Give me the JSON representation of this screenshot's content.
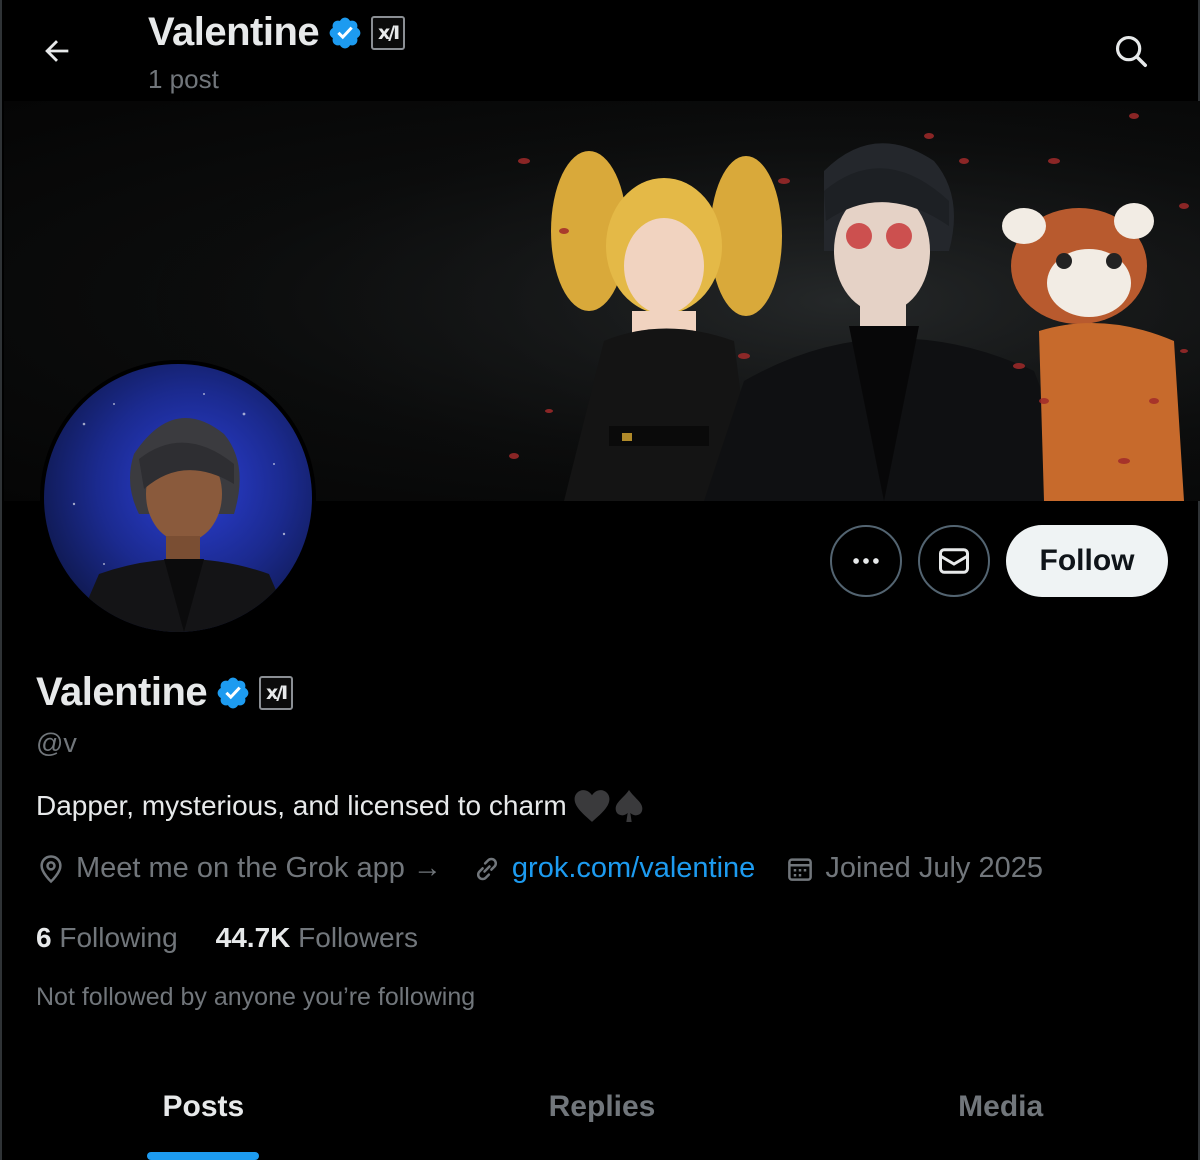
{
  "header": {
    "name": "Valentine",
    "post_count": "1 post",
    "back_icon": "arrow-left-icon",
    "search_icon": "search-icon"
  },
  "profile": {
    "name": "Valentine",
    "handle": "@v",
    "bio": "Dapper, mysterious, and licensed to charm",
    "bio_emoji": [
      "black-heart",
      "spade-suit"
    ],
    "location": "Meet me on the Grok app →",
    "link": "grok.com/valentine",
    "joined": "Joined July 2025",
    "following_count": "6",
    "following_label": "Following",
    "followers_count": "44.7K",
    "followers_label": "Followers",
    "not_followed": "Not followed by anyone you’re following",
    "badge_text": "x/I"
  },
  "actions": {
    "follow_label": "Follow",
    "more_icon": "more-dots-icon",
    "message_icon": "envelope-icon"
  },
  "tabs": [
    {
      "label": "Posts",
      "active": true
    },
    {
      "label": "Replies",
      "active": false
    },
    {
      "label": "Media",
      "active": false
    }
  ],
  "colors": {
    "background": "#000000",
    "accent": "#1d9bf0",
    "text_primary": "#e7e9ea",
    "text_secondary": "#71767b",
    "follow_bg": "#eff3f4",
    "verified": "#1d9bf0"
  }
}
